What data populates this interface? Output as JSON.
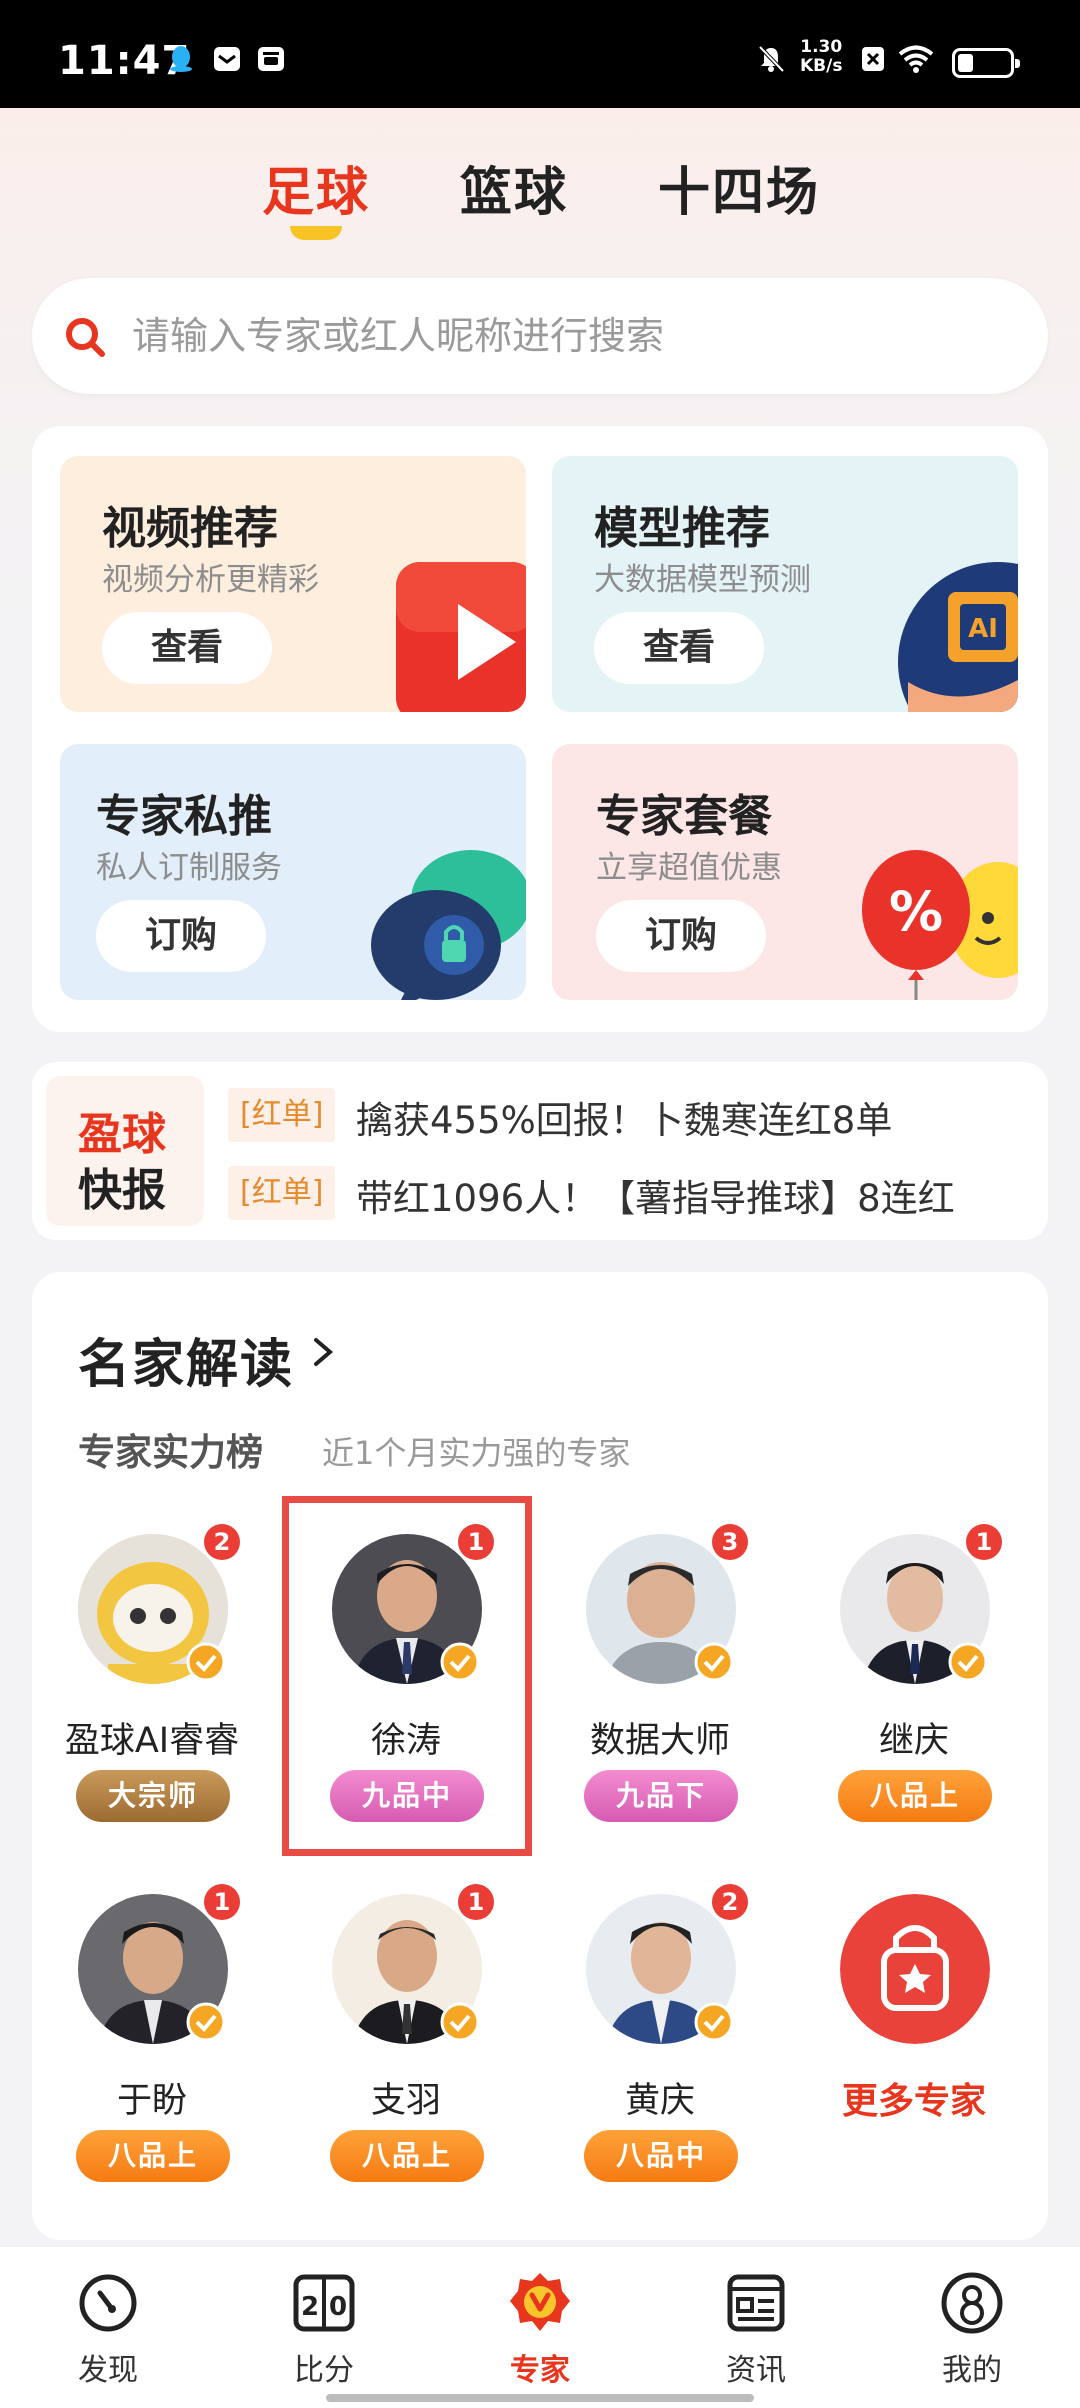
{
  "status_bar": {
    "time": "11:47",
    "net_speed_value": "1.30",
    "net_speed_unit": "KB/s",
    "battery_level": 0.3,
    "icons": [
      "qq-icon",
      "mail-icon",
      "notification-icon",
      "mute-icon",
      "no-sim-icon",
      "wifi-icon",
      "battery-icon"
    ]
  },
  "sport_tabs": [
    {
      "label": "足球",
      "active": true
    },
    {
      "label": "篮球",
      "active": false
    },
    {
      "label": "十四场",
      "active": false
    }
  ],
  "search": {
    "placeholder": "请输入专家或红人昵称进行搜索"
  },
  "features": [
    {
      "title": "视频推荐",
      "subtitle": "视频分析更精彩",
      "button": "查看",
      "bg": "#fdeedd",
      "icon": "video-play-icon"
    },
    {
      "title": "模型推荐",
      "subtitle": "大数据模型预测",
      "button": "查看",
      "bg": "#e4f3f6",
      "icon": "ai-chip-icon"
    },
    {
      "title": "专家私推",
      "subtitle": "私人订制服务",
      "button": "订购",
      "bg": "#e2eef9",
      "icon": "private-chat-lock-icon"
    },
    {
      "title": "专家套餐",
      "subtitle": "立享超值优惠",
      "button": "订购",
      "bg": "#fde6e6",
      "icon": "discount-balloon-icon"
    }
  ],
  "news": {
    "logo_line1": "盈球",
    "logo_line2": "快报",
    "items": [
      {
        "tag": "[红单]",
        "text": "擒获455%回报！卜魏寒连红8单"
      },
      {
        "tag": "[红单]",
        "text": "带红1096人！【薯指导推球】8连红"
      }
    ]
  },
  "experts_section": {
    "title": "名家解读",
    "subtitle": "专家实力榜",
    "description": "近1个月实力强的专家",
    "experts": [
      {
        "name": "盈球AI睿睿",
        "rank": "2",
        "grade": "大宗师",
        "grade_color": "gold"
      },
      {
        "name": "徐涛",
        "rank": "1",
        "grade": "九品中",
        "grade_color": "pink"
      },
      {
        "name": "数据大师",
        "rank": "3",
        "grade": "九品下",
        "grade_color": "pink"
      },
      {
        "name": "继庆",
        "rank": "1",
        "grade": "八品上",
        "grade_color": "orange"
      },
      {
        "name": "于盼",
        "rank": "1",
        "grade": "八品上",
        "grade_color": "orange"
      },
      {
        "name": "支羽",
        "rank": "1",
        "grade": "八品上",
        "grade_color": "orange"
      },
      {
        "name": "黄庆",
        "rank": "2",
        "grade": "八品中",
        "grade_color": "orange"
      }
    ],
    "more_label": "更多专家"
  },
  "bottom_nav": [
    {
      "label": "发现",
      "icon": "discover-icon",
      "active": false
    },
    {
      "label": "比分",
      "icon": "score-icon",
      "active": false
    },
    {
      "label": "专家",
      "icon": "expert-icon",
      "active": true
    },
    {
      "label": "资讯",
      "icon": "news-icon",
      "active": false
    },
    {
      "label": "我的",
      "icon": "profile-icon",
      "active": false
    }
  ],
  "colors": {
    "accent": "#e8361e",
    "highlight": "#f8c325",
    "badge": "#e93d35"
  }
}
